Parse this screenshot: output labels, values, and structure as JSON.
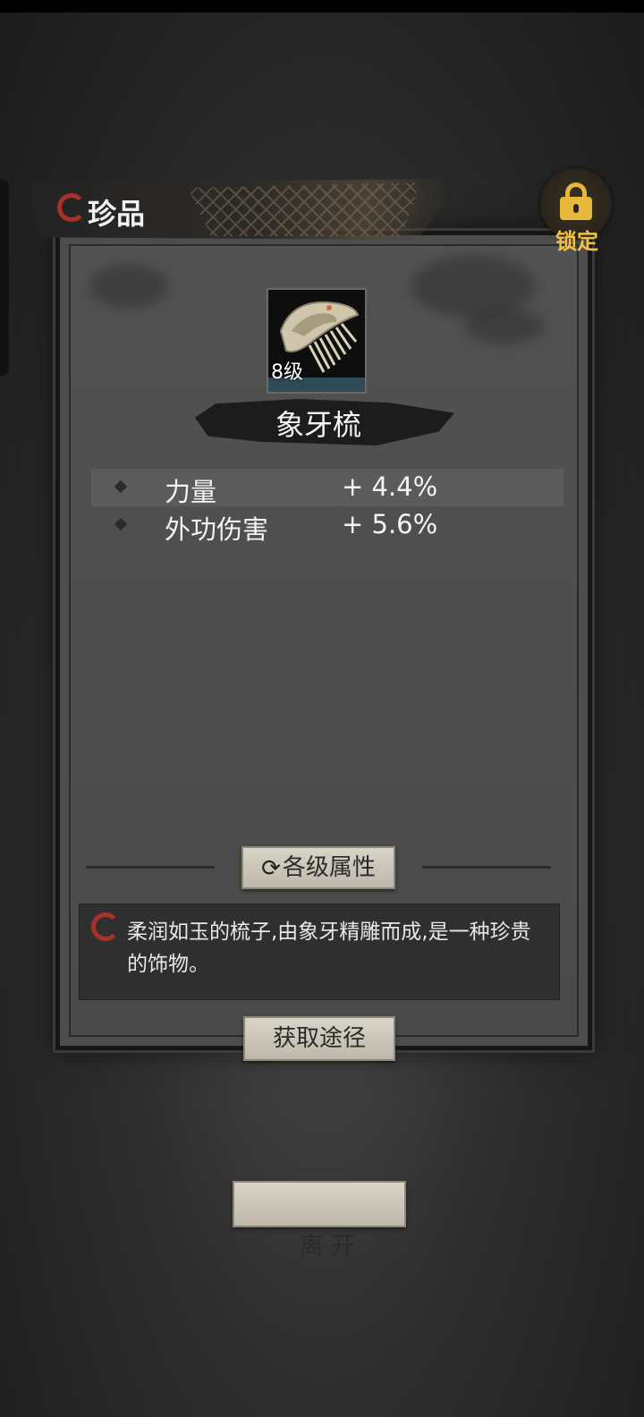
{
  "header": {
    "title": "珍品"
  },
  "lock": {
    "label": "锁定",
    "icon": "lock-icon",
    "color": "#e8b83d"
  },
  "item": {
    "level": "8级",
    "name": "象牙梳",
    "icon": "ivory-comb-icon"
  },
  "stats": [
    {
      "name": "力量",
      "value": "+ 4.4%"
    },
    {
      "name": "外功伤害",
      "value": "+ 5.6%"
    }
  ],
  "buttons": {
    "levels_label": "各级属性",
    "obtain_label": "获取途径",
    "leave_label": "离 开"
  },
  "description": "柔润如玉的梳子,由象牙精雕而成,是一种珍贵的饰物。",
  "colors": {
    "accent_red": "#a8322a",
    "lock_gold": "#e8b83d",
    "panel": "#4d4d4d"
  }
}
